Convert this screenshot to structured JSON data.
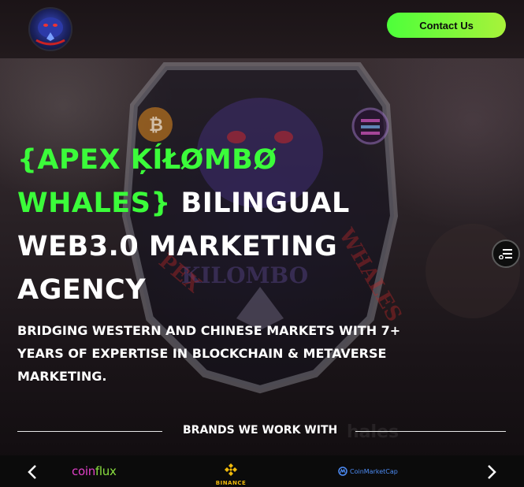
{
  "header": {
    "contact_label": "Contact Us",
    "logo_icon": "whale-gorilla-logo-icon"
  },
  "hero": {
    "title_green_1": "{APEX ĶÍŁØMBØ",
    "title_green_2": "WHALES}",
    "title_white_2": " BILINGUAL",
    "title_line_3": "WEB3.0 MARKETING",
    "title_line_4": "AGENCY",
    "subtitle": "BRIDGING WESTERN AND CHINESE MARKETS WITH 7+ YEARS OF EXPERTISE IN BLOCKCHAIN & METAVERSE MARKETING."
  },
  "brands": {
    "heading": "BRANDS WE WORK WITH",
    "items": [
      {
        "name": "coinflux",
        "text_a": "coin",
        "text_b": "flux"
      },
      {
        "name": "binance",
        "text": "BINANCE"
      },
      {
        "name": "coinmarketcap",
        "text": "CoinMarketCap"
      }
    ],
    "prev_icon": "chevron-left-icon",
    "next_icon": "chevron-right-icon"
  },
  "floating": {
    "icon": "menu-list-icon"
  },
  "colors": {
    "accent_green": "#3bfc3a",
    "button_gradient_end": "#a8f23a",
    "binance_yellow": "#f0b90b",
    "cmc_blue": "#4d8cf5",
    "coinflux_pink": "#e040c8"
  }
}
